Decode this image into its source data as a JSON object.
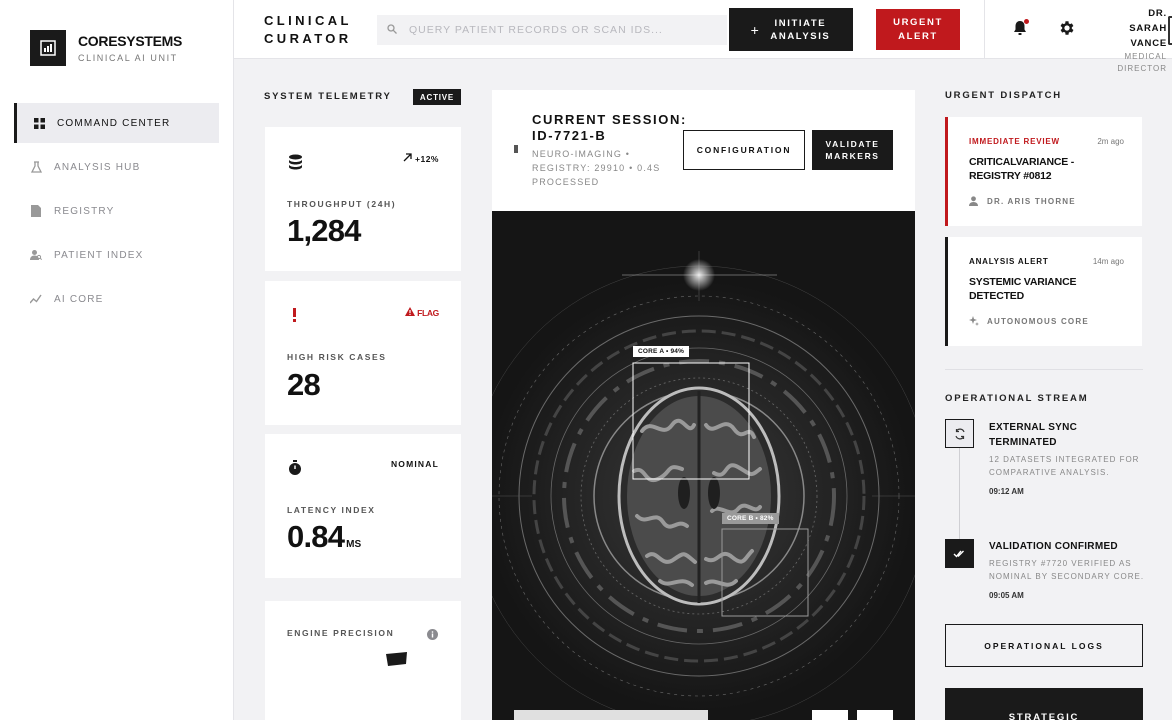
{
  "brand": {
    "name": "CORESYSTEMS",
    "subtitle": "CLINICAL AI UNIT"
  },
  "nav": {
    "items": [
      {
        "label": "COMMAND CENTER",
        "icon": "grid-icon",
        "active": true
      },
      {
        "label": "ANALYSIS HUB",
        "icon": "flask-icon",
        "active": false
      },
      {
        "label": "REGISTRY",
        "icon": "document-icon",
        "active": false
      },
      {
        "label": "PATIENT INDEX",
        "icon": "person-search-icon",
        "active": false
      },
      {
        "label": "AI CORE",
        "icon": "trend-icon",
        "active": false
      }
    ]
  },
  "header": {
    "title_line1": "CLINICAL",
    "title_line2": "CURATOR",
    "search_placeholder": "QUERY PATIENT RECORDS OR SCAN IDS...",
    "initiate_label": "INITIATE ANALYSIS",
    "urgent_label": "URGENT ALERT",
    "user_name_line1": "DR.",
    "user_name_line2": "SARAH",
    "user_name_line3": "VANCE",
    "user_role_line1": "MEDICAL",
    "user_role_line2": "DIRECTOR"
  },
  "telemetry": {
    "heading": "SYSTEM TELEMETRY",
    "status": "ACTIVE",
    "cards": [
      {
        "icon": "database-icon",
        "tag": "+12%",
        "label": "THROUGHPUT (24H)",
        "value": "1,284",
        "unit": ""
      },
      {
        "icon": "exclamation-icon",
        "tag": "FLAG",
        "label": "HIGH RISK CASES",
        "value": "28",
        "unit": ""
      },
      {
        "icon": "stopwatch-icon",
        "tag": "NOMINAL",
        "label": "LATENCY INDEX",
        "value": "0.84",
        "unit": "MS"
      },
      {
        "icon": "info-icon",
        "tag": "",
        "label": "ENGINE PRECISION",
        "value": "",
        "unit": ""
      }
    ]
  },
  "session": {
    "title_line1": "CURRENT SESSION:",
    "title_line2": "ID-7721-B",
    "meta": "NEURO-IMAGING • REGISTRY: 29910 • 0.4S PROCESSED",
    "config_label": "CONFIGURATION",
    "validate_label": "VALIDATE MARKERS",
    "markers": [
      {
        "label": "CORE A • 94%"
      },
      {
        "label": "CORE B • 82%"
      }
    ]
  },
  "dispatch": {
    "heading": "URGENT DISPATCH",
    "alerts": [
      {
        "kind": "IMMEDIATE REVIEW",
        "time": "2m ago",
        "title": "CRITICALVARIANCE - REGISTRY #0812",
        "by": "DR. ARIS THORNE",
        "by_icon": "user-icon",
        "accent": "#c0191d"
      },
      {
        "kind": "ANALYSIS ALERT",
        "time": "14m ago",
        "title": "SYSTEMIC VARIANCE DETECTED",
        "by": "AUTONOMOUS CORE",
        "by_icon": "sparkle-icon",
        "accent": "#1a1a1a"
      }
    ]
  },
  "stream": {
    "heading": "OPERATIONAL STREAM",
    "events": [
      {
        "icon": "sync-icon",
        "title_line1": "EXTERNAL SYNC",
        "title_line2": "TERMINATED",
        "desc": "12 DATASETS INTEGRATED FOR COMPARATIVE ANALYSIS.",
        "time": "09:12 AM"
      },
      {
        "icon": "double-check-icon",
        "title_line1": "VALIDATION CONFIRMED",
        "title_line2": "",
        "desc": "REGISTRY #7720 VERIFIED AS NOMINAL BY SECONDARY CORE.",
        "time": "09:05 AM"
      }
    ],
    "logs_label": "OPERATIONAL LOGS",
    "strategic_label": "STRATEGIC"
  },
  "colors": {
    "accent_red": "#c0191d",
    "ink": "#1a1a1a",
    "surface": "#f2f2f4"
  }
}
